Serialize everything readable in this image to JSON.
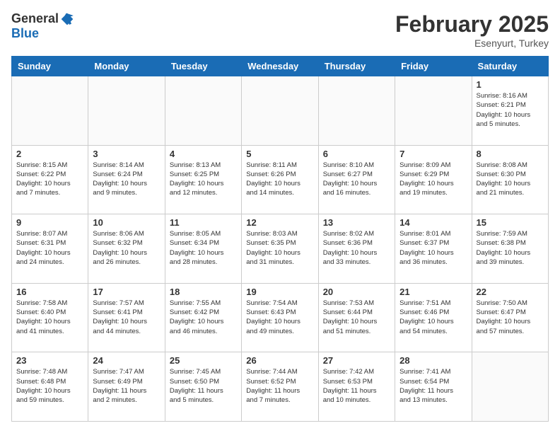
{
  "logo": {
    "general": "General",
    "blue": "Blue"
  },
  "header": {
    "month": "February 2025",
    "location": "Esenyurt, Turkey"
  },
  "days_of_week": [
    "Sunday",
    "Monday",
    "Tuesday",
    "Wednesday",
    "Thursday",
    "Friday",
    "Saturday"
  ],
  "weeks": [
    [
      {
        "day": "",
        "info": ""
      },
      {
        "day": "",
        "info": ""
      },
      {
        "day": "",
        "info": ""
      },
      {
        "day": "",
        "info": ""
      },
      {
        "day": "",
        "info": ""
      },
      {
        "day": "",
        "info": ""
      },
      {
        "day": "1",
        "info": "Sunrise: 8:16 AM\nSunset: 6:21 PM\nDaylight: 10 hours\nand 5 minutes."
      }
    ],
    [
      {
        "day": "2",
        "info": "Sunrise: 8:15 AM\nSunset: 6:22 PM\nDaylight: 10 hours\nand 7 minutes."
      },
      {
        "day": "3",
        "info": "Sunrise: 8:14 AM\nSunset: 6:24 PM\nDaylight: 10 hours\nand 9 minutes."
      },
      {
        "day": "4",
        "info": "Sunrise: 8:13 AM\nSunset: 6:25 PM\nDaylight: 10 hours\nand 12 minutes."
      },
      {
        "day": "5",
        "info": "Sunrise: 8:11 AM\nSunset: 6:26 PM\nDaylight: 10 hours\nand 14 minutes."
      },
      {
        "day": "6",
        "info": "Sunrise: 8:10 AM\nSunset: 6:27 PM\nDaylight: 10 hours\nand 16 minutes."
      },
      {
        "day": "7",
        "info": "Sunrise: 8:09 AM\nSunset: 6:29 PM\nDaylight: 10 hours\nand 19 minutes."
      },
      {
        "day": "8",
        "info": "Sunrise: 8:08 AM\nSunset: 6:30 PM\nDaylight: 10 hours\nand 21 minutes."
      }
    ],
    [
      {
        "day": "9",
        "info": "Sunrise: 8:07 AM\nSunset: 6:31 PM\nDaylight: 10 hours\nand 24 minutes."
      },
      {
        "day": "10",
        "info": "Sunrise: 8:06 AM\nSunset: 6:32 PM\nDaylight: 10 hours\nand 26 minutes."
      },
      {
        "day": "11",
        "info": "Sunrise: 8:05 AM\nSunset: 6:34 PM\nDaylight: 10 hours\nand 28 minutes."
      },
      {
        "day": "12",
        "info": "Sunrise: 8:03 AM\nSunset: 6:35 PM\nDaylight: 10 hours\nand 31 minutes."
      },
      {
        "day": "13",
        "info": "Sunrise: 8:02 AM\nSunset: 6:36 PM\nDaylight: 10 hours\nand 33 minutes."
      },
      {
        "day": "14",
        "info": "Sunrise: 8:01 AM\nSunset: 6:37 PM\nDaylight: 10 hours\nand 36 minutes."
      },
      {
        "day": "15",
        "info": "Sunrise: 7:59 AM\nSunset: 6:38 PM\nDaylight: 10 hours\nand 39 minutes."
      }
    ],
    [
      {
        "day": "16",
        "info": "Sunrise: 7:58 AM\nSunset: 6:40 PM\nDaylight: 10 hours\nand 41 minutes."
      },
      {
        "day": "17",
        "info": "Sunrise: 7:57 AM\nSunset: 6:41 PM\nDaylight: 10 hours\nand 44 minutes."
      },
      {
        "day": "18",
        "info": "Sunrise: 7:55 AM\nSunset: 6:42 PM\nDaylight: 10 hours\nand 46 minutes."
      },
      {
        "day": "19",
        "info": "Sunrise: 7:54 AM\nSunset: 6:43 PM\nDaylight: 10 hours\nand 49 minutes."
      },
      {
        "day": "20",
        "info": "Sunrise: 7:53 AM\nSunset: 6:44 PM\nDaylight: 10 hours\nand 51 minutes."
      },
      {
        "day": "21",
        "info": "Sunrise: 7:51 AM\nSunset: 6:46 PM\nDaylight: 10 hours\nand 54 minutes."
      },
      {
        "day": "22",
        "info": "Sunrise: 7:50 AM\nSunset: 6:47 PM\nDaylight: 10 hours\nand 57 minutes."
      }
    ],
    [
      {
        "day": "23",
        "info": "Sunrise: 7:48 AM\nSunset: 6:48 PM\nDaylight: 10 hours\nand 59 minutes."
      },
      {
        "day": "24",
        "info": "Sunrise: 7:47 AM\nSunset: 6:49 PM\nDaylight: 11 hours\nand 2 minutes."
      },
      {
        "day": "25",
        "info": "Sunrise: 7:45 AM\nSunset: 6:50 PM\nDaylight: 11 hours\nand 5 minutes."
      },
      {
        "day": "26",
        "info": "Sunrise: 7:44 AM\nSunset: 6:52 PM\nDaylight: 11 hours\nand 7 minutes."
      },
      {
        "day": "27",
        "info": "Sunrise: 7:42 AM\nSunset: 6:53 PM\nDaylight: 11 hours\nand 10 minutes."
      },
      {
        "day": "28",
        "info": "Sunrise: 7:41 AM\nSunset: 6:54 PM\nDaylight: 11 hours\nand 13 minutes."
      },
      {
        "day": "",
        "info": ""
      }
    ]
  ]
}
